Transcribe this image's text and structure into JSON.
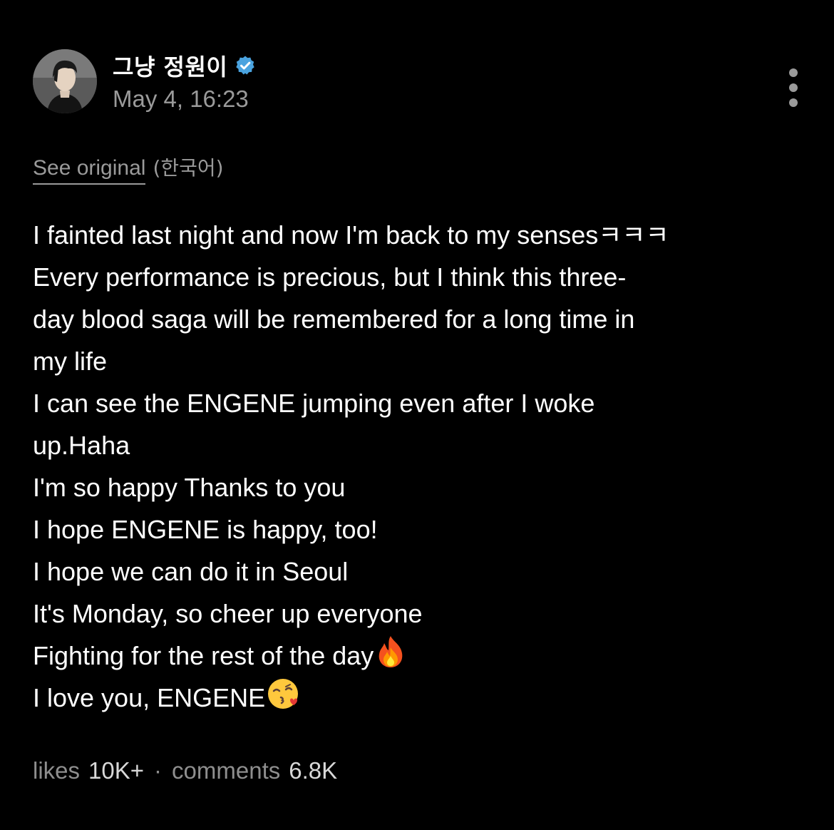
{
  "post": {
    "author": {
      "name": "그냥 정원이",
      "verified": true,
      "avatar_icon": "profile-photo"
    },
    "timestamp": "May 4, 16:23",
    "more_icon": "vertical-ellipsis-icon",
    "translation": {
      "see_original_label": "See original",
      "original_language": "(한국어)"
    },
    "body_lines": [
      "I fainted last night and now I'm back to my sensesㅋㅋㅋ",
      "Every performance is precious, but I think this three-",
      "day blood saga will be remembered for a long time in",
      "my life",
      "I can see the ENGENE jumping even after I woke",
      "up.Haha",
      "I'm so happy Thanks to you",
      "I hope ENGENE is happy, too!",
      "I hope we can do it in Seoul",
      "It's Monday, so cheer up everyone",
      "Fighting for the rest of the day",
      "I love you, ENGENE"
    ],
    "emojis": {
      "fire": "fire-emoji",
      "kiss": "face-blowing-kiss-emoji"
    },
    "stats": {
      "likes_label": "likes",
      "likes_value": "10K+",
      "separator": "·",
      "comments_label": "comments",
      "comments_value": "6.8K"
    }
  },
  "colors": {
    "background": "#000000",
    "text_primary": "#ffffff",
    "text_secondary": "#9a9a9a",
    "verified_badge": "#4aa3df"
  }
}
